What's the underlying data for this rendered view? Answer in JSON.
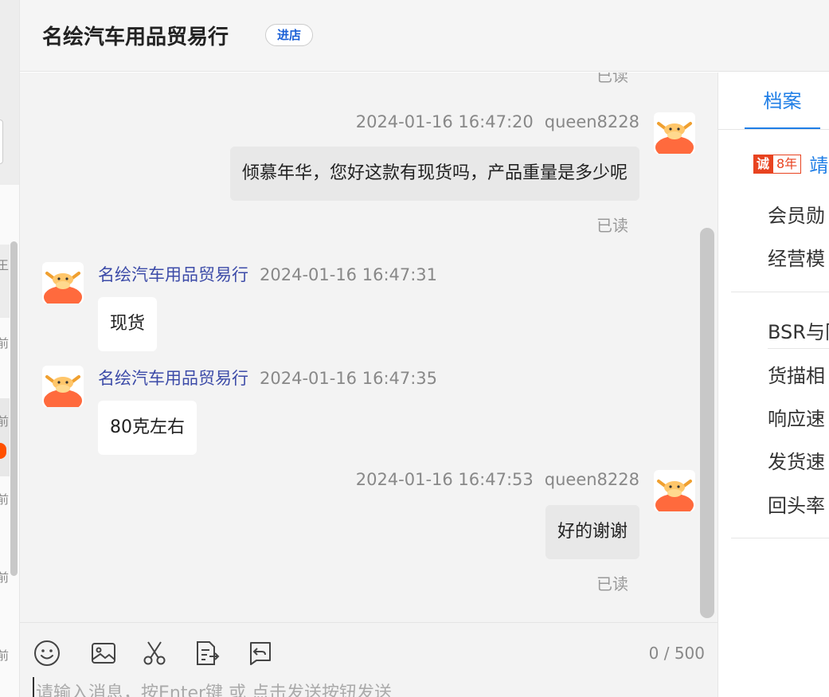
{
  "header": {
    "shop_name": "名绘汽车用品贸易行",
    "enter_label": "进店"
  },
  "left_list": {
    "cut_labels": [
      "王",
      "前",
      "前",
      "前",
      "前",
      "前"
    ]
  },
  "messages": {
    "top_read": "已读",
    "items": [
      {
        "side": "me",
        "timestamp": "2024-01-16 16:47:20",
        "sender": "queen8228",
        "text": "倾慕年华，您好这款有现货吗，产品重量是多少呢",
        "status": "已读"
      },
      {
        "side": "them",
        "timestamp": "2024-01-16 16:47:31",
        "sender": "名绘汽车用品贸易行",
        "text": "现货"
      },
      {
        "side": "them",
        "timestamp": "2024-01-16 16:47:35",
        "sender": "名绘汽车用品贸易行",
        "text": "80克左右"
      },
      {
        "side": "me",
        "timestamp": "2024-01-16 16:47:53",
        "sender": "queen8228",
        "text": "好的谢谢",
        "status": "已读"
      }
    ]
  },
  "composer": {
    "counter": "0 / 500",
    "placeholder": "请输入消息，按Enter键 或 点击发送按钮发送",
    "tools": [
      "emoji-icon",
      "image-icon",
      "scissors-icon",
      "document-send-icon",
      "recall-icon"
    ]
  },
  "right_panel": {
    "tab_label": "档案",
    "cheng_badge": "诚",
    "years": "8年",
    "link_cut": "靖",
    "group1": [
      "会员勋",
      "经营模"
    ],
    "group2": [
      "BSR与同",
      "货描相",
      "响应速",
      "发货速",
      "回头率"
    ]
  },
  "colors": {
    "accent": "#1f7ee6",
    "sender_name": "#3c4ba8",
    "brand_orange": "#ff6a3d"
  }
}
